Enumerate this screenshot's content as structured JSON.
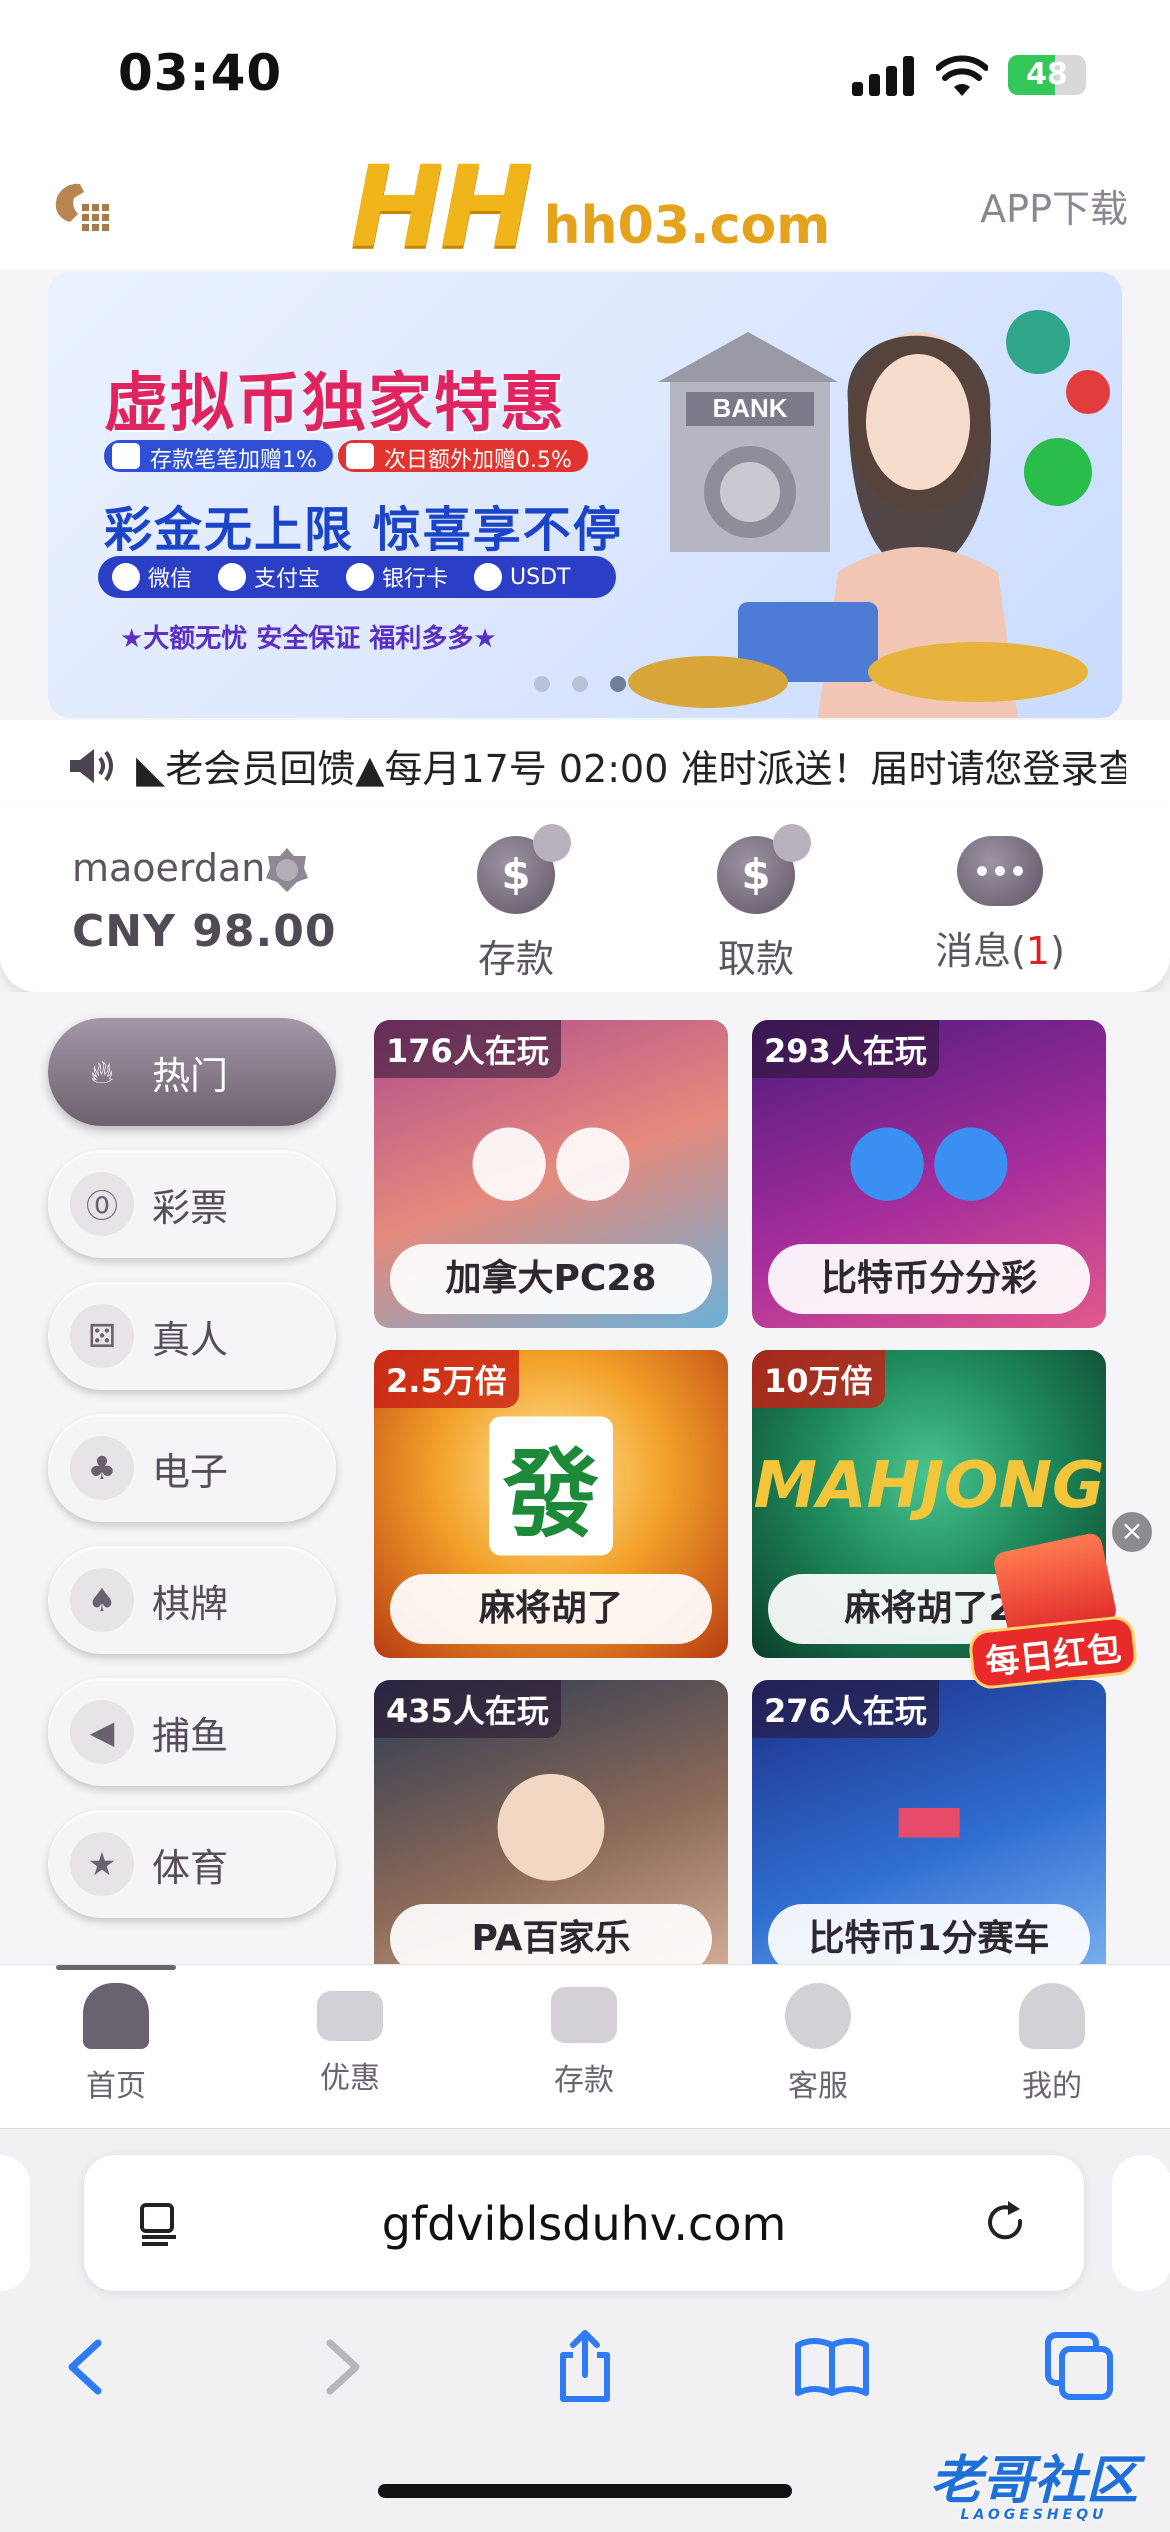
{
  "status": {
    "time": "03:40",
    "battery": "48"
  },
  "header": {
    "logo_main": "HH",
    "logo_domain": "hh03.com",
    "app_download": "APP下载"
  },
  "banner": {
    "title": "虚拟币独家特惠",
    "pill1": "存款笔笔加赠1%",
    "pill2": "次日额外加赠0.5%",
    "subtitle": "彩金无上限 惊喜享不停",
    "methods": [
      "微信",
      "支付宝",
      "银行卡",
      "USDT"
    ],
    "footer": "★大额无忧 安全保证 福利多多★",
    "bank_sign": "BANK"
  },
  "marquee": {
    "text": "◣老会员回馈▲每月17号 02:00 准时派送！届时请您登录查"
  },
  "user": {
    "username": "maoerdan",
    "balance": "CNY 98.00",
    "deposit": "存款",
    "withdraw": "取款",
    "messages": "消息(",
    "messages_count": "1",
    "messages_close": ")"
  },
  "categories": [
    {
      "label": "热门",
      "icon": "flame-icon"
    },
    {
      "label": "彩票",
      "icon": "lottery-ball-icon"
    },
    {
      "label": "真人",
      "icon": "dice-icon"
    },
    {
      "label": "电子",
      "icon": "cherry-icon"
    },
    {
      "label": "棋牌",
      "icon": "cards-icon"
    },
    {
      "label": "捕鱼",
      "icon": "fish-icon"
    },
    {
      "label": "体育",
      "icon": "trophy-icon"
    }
  ],
  "games": [
    {
      "badge": "176人在玩",
      "name": "加拿大PC28"
    },
    {
      "badge": "293人在玩",
      "name": "比特币分分彩"
    },
    {
      "badge": "2.5万倍",
      "name": "麻将胡了"
    },
    {
      "badge": "10万倍",
      "name": "麻将胡了2"
    },
    {
      "badge": "435人在玩",
      "name": "PA百家乐"
    },
    {
      "badge": "276人在玩",
      "name": "比特币1分赛车"
    }
  ],
  "redpack": {
    "label": "每日红包"
  },
  "tabs": [
    "首页",
    "优惠",
    "存款",
    "客服",
    "我的"
  ],
  "safari": {
    "url": "gfdviblsduhv.com"
  },
  "watermark": {
    "main": "老哥社区",
    "sub": "LAOGESHEQU"
  },
  "colors": {
    "accent": "#6b6270",
    "gold": "#f1b51c",
    "red": "#e02020"
  }
}
